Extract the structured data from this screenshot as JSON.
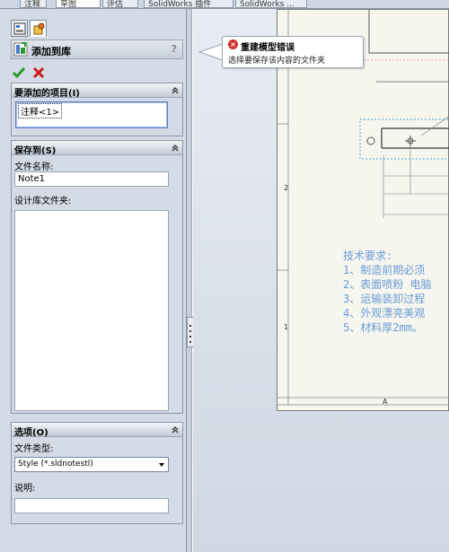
{
  "top_tabs": [
    "注释",
    "草图",
    "评估",
    "SolidWorks 插件",
    "SolidWorks ..."
  ],
  "panel": {
    "tabs": [
      {
        "icon": "property-manager-icon"
      },
      {
        "icon": "configuration-icon"
      }
    ],
    "title": "添加到库",
    "help": "?",
    "ok_icon": "check-icon",
    "cancel_icon": "close-icon"
  },
  "items_group": {
    "title": "要添加的项目(I)",
    "items": [
      "注释<1>"
    ]
  },
  "save_group": {
    "title": "保存到(S)",
    "file_name_label": "文件名称:",
    "file_name_value": "Note1",
    "design_lib_label": "设计库文件夹:"
  },
  "options_group": {
    "title": "选项(O)",
    "file_type_label": "文件类型:",
    "file_type_value": "Style (*.sldnotestl)",
    "description_label": "说明:",
    "description_value": ""
  },
  "tooltip": {
    "title": "重建模型错误",
    "message": "选择要保存该内容的文件夹",
    "icon": "error-icon"
  },
  "drawing": {
    "tech_lines": [
      "技术要求:",
      "1、制造前期必须",
      "2、表面喷粉 电脑",
      "3、运输装卸过程",
      "4、外观漂亮美观",
      "5、材料厚2mm。"
    ],
    "zone_labels": [
      "2",
      "1",
      "A"
    ]
  },
  "colors": {
    "panel_bg": "#d4dbe6",
    "note_text": "#6a9ad8",
    "error": "#d03030",
    "ok_green": "#2a9a2a",
    "cancel_red": "#cc1b1b"
  }
}
